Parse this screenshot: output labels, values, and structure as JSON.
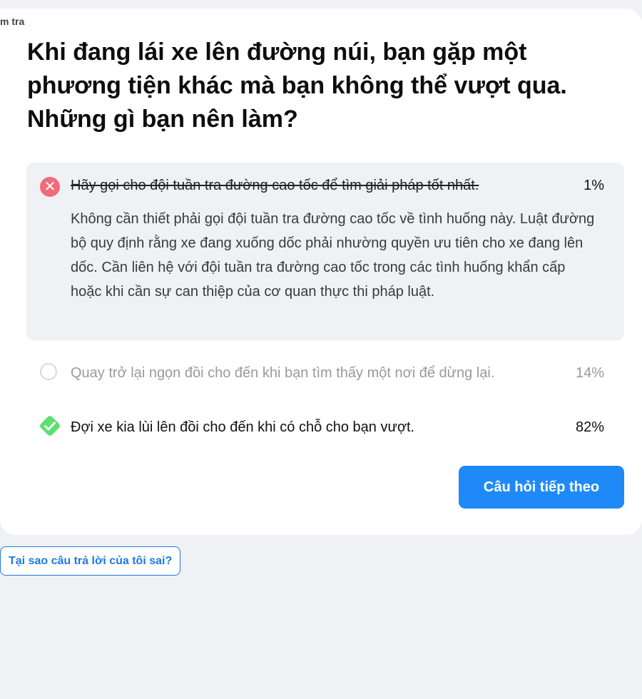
{
  "breadcrumb": "m tra",
  "question": "Khi đang lái xe lên đường núi, bạn gặp một phương tiện khác mà bạn không thể vượt qua. Những gì bạn nên làm?",
  "answers": [
    {
      "text": "Hãy gọi cho đội tuần tra đường cao tốc để tìm giải pháp tốt nhất.",
      "percent": "1%",
      "state": "selected-wrong",
      "explanation": "Không cần thiết phải gọi đội tuần tra đường cao tốc về tình huống này. Luật đường bộ quy định rằng xe đang xuống dốc phải nhường quyền ưu tiên cho xe đang lên dốc. Cần liên hệ với đội tuần tra đường cao tốc trong các tình huống khẩn cấp hoặc khi cần sự can thiệp của cơ quan thực thi pháp luật."
    },
    {
      "text": "Quay trở lại ngọn đồi cho đến khi bạn tìm thấy một nơi để dừng lại.",
      "percent": "14%",
      "state": "unselected"
    },
    {
      "text": "Đợi xe kia lùi lên đồi cho đến khi có chỗ cho bạn vượt.",
      "percent": "82%",
      "state": "correct"
    }
  ],
  "buttons": {
    "next": "Câu hỏi tiếp theo",
    "why_wrong": "Tại sao câu trả lời của tôi sai?"
  },
  "icons": {
    "wrong": "x-circle-icon",
    "unselected": "radio-empty-icon",
    "correct": "check-diamond-icon"
  },
  "colors": {
    "wrong": "#f26b7a",
    "correct": "#5ee06f",
    "primary": "#1f8af7"
  }
}
